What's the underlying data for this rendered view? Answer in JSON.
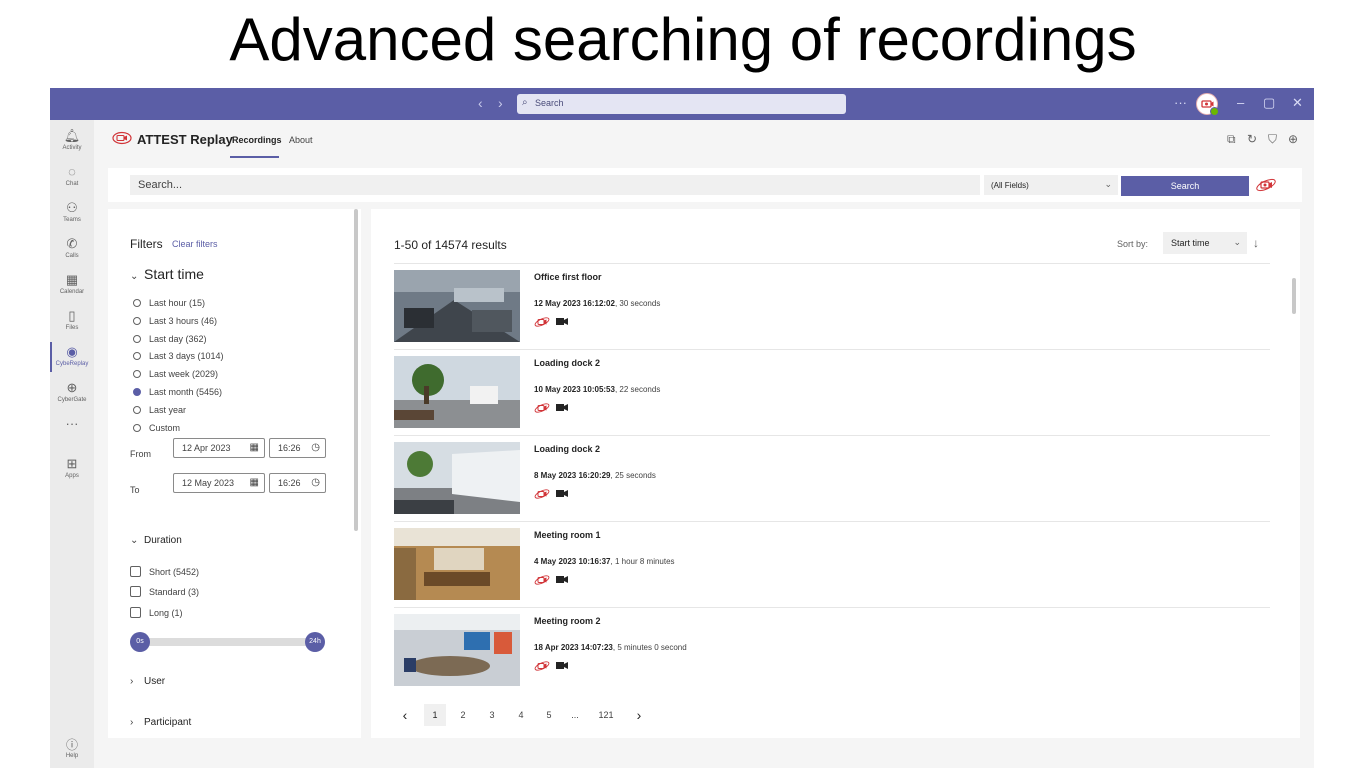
{
  "slide": {
    "title": "Advanced searching of recordings"
  },
  "titlebar": {
    "search_placeholder": "Search",
    "more": "···"
  },
  "rail": [
    {
      "label": "Activity",
      "icon": "bell-icon"
    },
    {
      "label": "Chat",
      "icon": "chat-icon"
    },
    {
      "label": "Teams",
      "icon": "teams-icon"
    },
    {
      "label": "Calls",
      "icon": "phone-icon"
    },
    {
      "label": "Calendar",
      "icon": "calendar-icon"
    },
    {
      "label": "Files",
      "icon": "file-icon"
    },
    {
      "label": "CybeReplay",
      "icon": "replay-icon",
      "active": true
    },
    {
      "label": "CyberGate",
      "icon": "gate-icon"
    },
    {
      "label": "···",
      "icon": "more-icon"
    },
    {
      "label": "Apps",
      "icon": "apps-icon"
    }
  ],
  "help": {
    "label": "Help"
  },
  "app": {
    "name": "ATTEST Replay",
    "tabs": [
      {
        "label": "Recordings",
        "active": true
      },
      {
        "label": "About"
      }
    ]
  },
  "search": {
    "placeholder": "Search...",
    "field": "(All Fields)",
    "button": "Search"
  },
  "filters": {
    "title": "Filters",
    "clear": "Clear filters",
    "start_time": {
      "title": "Start time",
      "options": [
        "Last hour (15)",
        "Last 3 hours (46)",
        "Last day (362)",
        "Last 3 days (1014)",
        "Last week (2029)",
        "Last month (5456)",
        "Last year",
        "Custom"
      ],
      "selected_index": 5,
      "from_label": "From",
      "to_label": "To",
      "from_date": "12 Apr 2023",
      "from_time": "16:26",
      "to_date": "12 May 2023",
      "to_time": "16:26"
    },
    "duration": {
      "title": "Duration",
      "options": [
        "Short (5452)",
        "Standard (3)",
        "Long (1)"
      ],
      "slider_min": "0s",
      "slider_max": "24h"
    },
    "user": {
      "title": "User"
    },
    "participant": {
      "title": "Participant"
    }
  },
  "results": {
    "count": "1-50 of 14574 results",
    "sort_label": "Sort by:",
    "sort_value": "Start time",
    "items": [
      {
        "title": "Office first floor",
        "datetime": "12 May 2023 16:12:02",
        "duration": ", 30 seconds"
      },
      {
        "title": "Loading dock 2",
        "datetime": "10 May 2023 10:05:53",
        "duration": ", 22 seconds"
      },
      {
        "title": "Loading dock 2",
        "datetime": "8 May 2023 16:20:29",
        "duration": ", 25 seconds"
      },
      {
        "title": "Meeting room 1",
        "datetime": "4 May 2023 10:16:37",
        "duration": ", 1 hour 8 minutes"
      },
      {
        "title": "Meeting room 2",
        "datetime": "18 Apr 2023 14:07:23",
        "duration": ", 5 minutes 0 second"
      }
    ],
    "pages": [
      "1",
      "2",
      "3",
      "4",
      "5",
      "...",
      "121"
    ],
    "current_page": "1"
  }
}
